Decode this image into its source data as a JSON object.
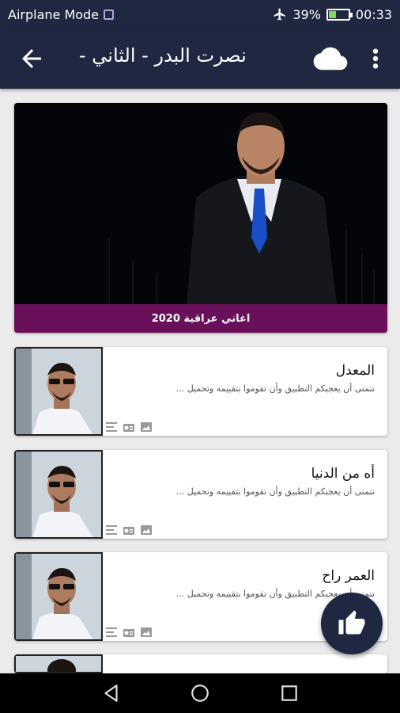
{
  "status_bar": {
    "mode": "Airplane Mode",
    "battery": "39%",
    "battery_level": 0.39,
    "time": "00:33"
  },
  "app_bar": {
    "title": "نصرت البدر - الثاني -",
    "back_icon": "arrow-back-icon",
    "cloud_icon": "cloud-icon",
    "menu_icon": "more-vert-icon"
  },
  "banner": {
    "caption": "اغاني عراقية 2020"
  },
  "songs": [
    {
      "title": "المعدل",
      "description": "نتمنى أن يعجبكم التطبيق وأن تقوموا بتقييمه وتحميل ..."
    },
    {
      "title": "أه من الدنيا",
      "description": "نتمنى أن يعجبكم التطبيق وأن تقوموا بتقييمه وتحميل ..."
    },
    {
      "title": "العمر راح",
      "description": "نتمنى أن يعجبكم التطبيق وأن تقوموا بتقييمه وتحميل ..."
    }
  ],
  "card_icons": [
    "lyrics-icon",
    "radio-icon",
    "image-icon"
  ],
  "fab": {
    "icon": "thumb-up-icon"
  },
  "colors": {
    "primary": "#1f2741",
    "banner_caption_bg": "#6a0f5a",
    "background": "#ebebeb"
  }
}
